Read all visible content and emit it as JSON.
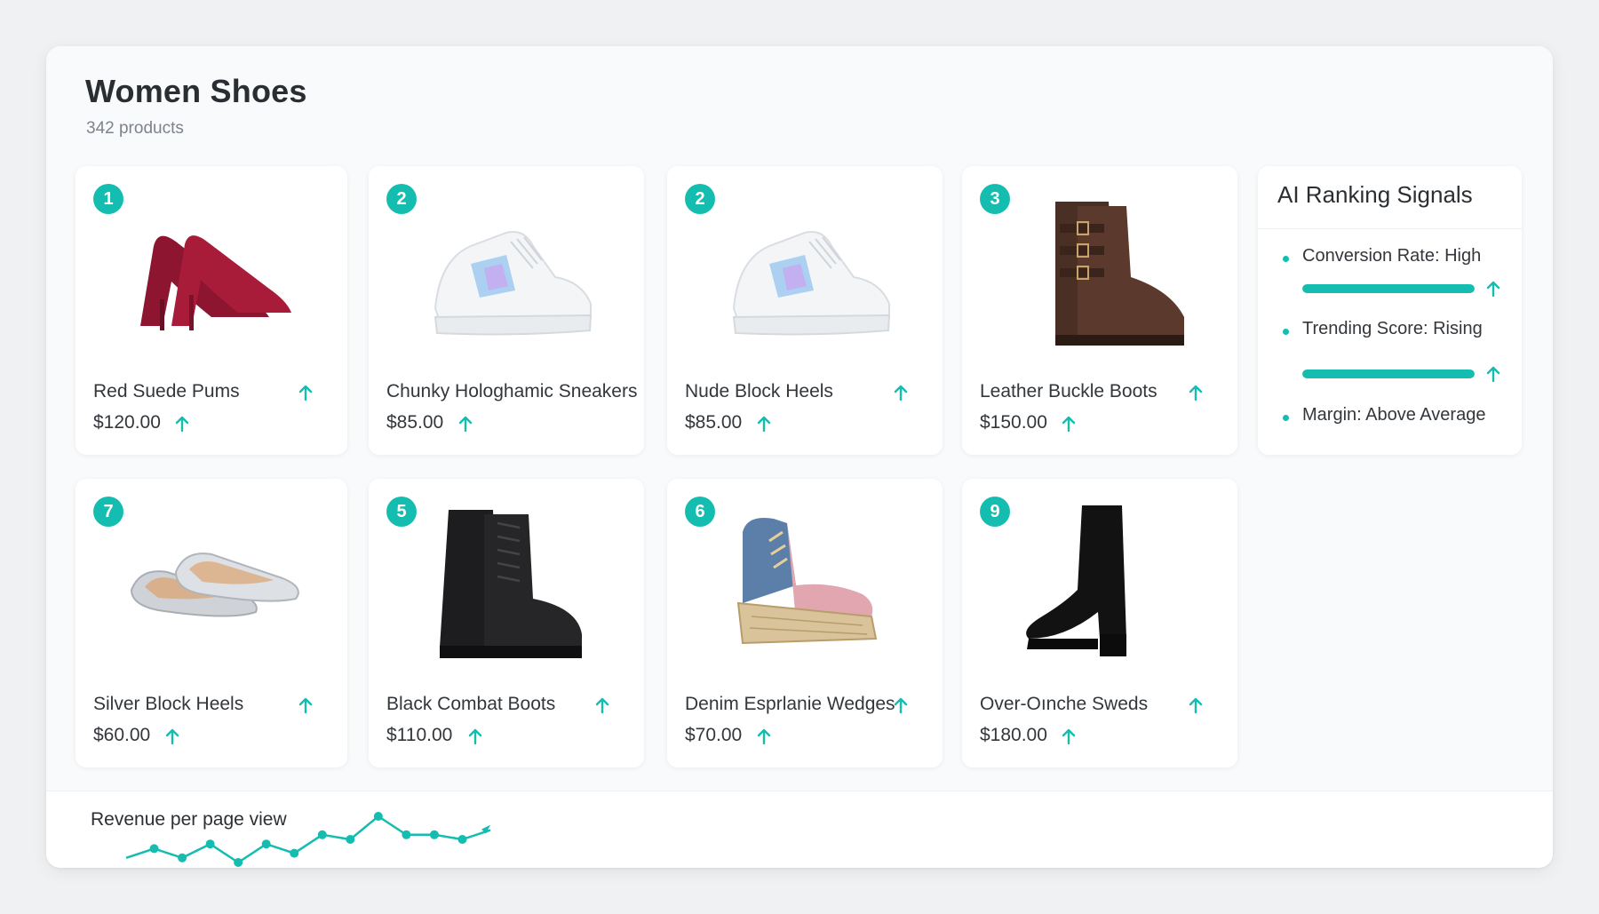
{
  "header": {
    "title": "Women Shoes",
    "count": "342 products"
  },
  "products": [
    {
      "rank": "1",
      "name": "Red Suede Pums",
      "price": "$120.00",
      "image": "red-pump-icon"
    },
    {
      "rank": "2",
      "name": "Chunky Hologhamic Sneakers",
      "price": "$85.00",
      "image": "sneaker-icon"
    },
    {
      "rank": "2",
      "name": "Nude Block Heels",
      "price": "$85.00",
      "image": "sneaker-icon"
    },
    {
      "rank": "3",
      "name": "Leather Buckle Boots",
      "price": "$150.00",
      "image": "buckle-boot-icon"
    },
    {
      "rank": "7",
      "name": "Silver Block Heels",
      "price": "$60.00",
      "image": "silver-flat-icon"
    },
    {
      "rank": "5",
      "name": "Black Combat Boots",
      "price": "$110.00",
      "image": "combat-boot-icon"
    },
    {
      "rank": "6",
      "name": "Denim Esprlanie Wedges",
      "price": "$70.00",
      "image": "wedge-icon"
    },
    {
      "rank": "9",
      "name": "Over-Oınche Sweds",
      "price": "$180.00",
      "image": "tall-boot-icon"
    }
  ],
  "signals": {
    "title": "AI Ranking Signals",
    "items": [
      {
        "label": "Conversion Rate: High",
        "level": 1.0
      },
      {
        "label": "Trending Score: Rising",
        "level": 1.0
      },
      {
        "label": "Margin: Above Average"
      }
    ]
  },
  "revenue": {
    "label": "Revenue per page view",
    "trend": [
      3,
      5,
      3,
      6,
      2,
      6,
      4,
      8,
      7,
      12,
      8,
      8,
      7,
      9
    ]
  },
  "colors": {
    "accent": "#14bdb0",
    "background": "#f0f1f3",
    "card": "#ffffff"
  }
}
